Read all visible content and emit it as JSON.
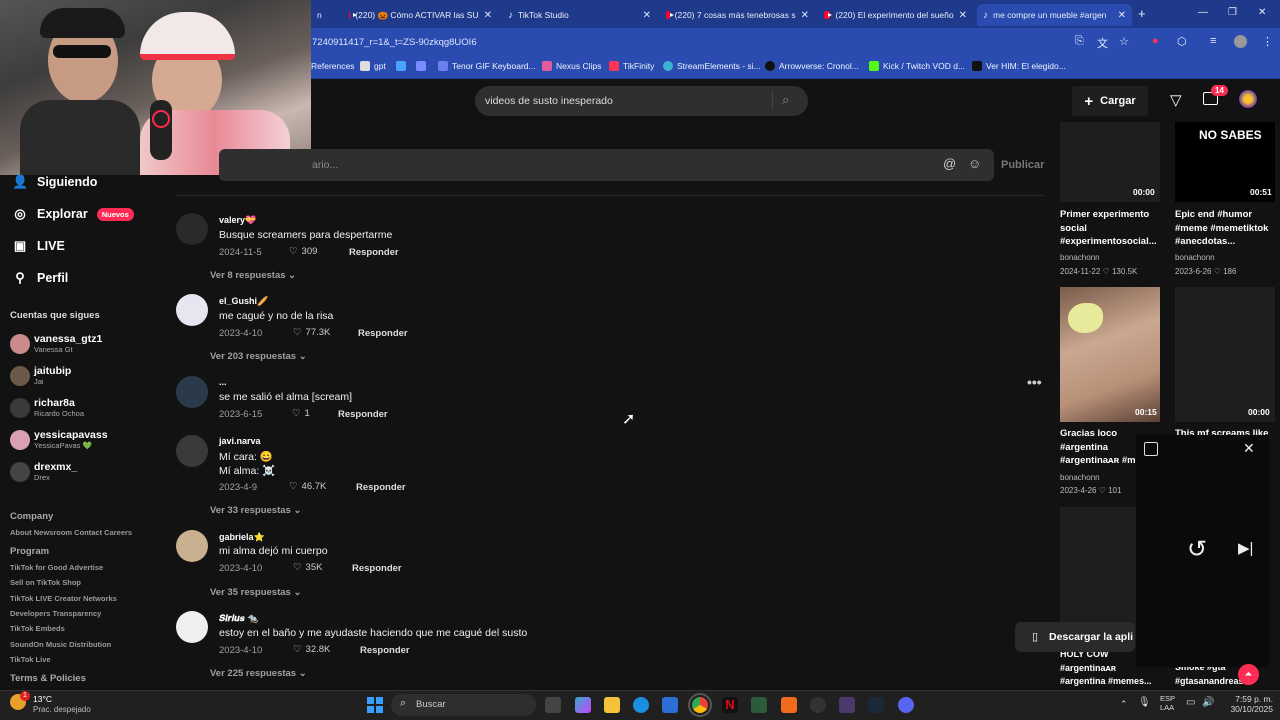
{
  "browser": {
    "tabs": [
      {
        "label": "n",
        "icon": "none"
      },
      {
        "label": "(220) 🎃 Cómo ACTIVAR las SU",
        "icon": "youtube-icon"
      },
      {
        "label": "TikTok Studio",
        "icon": "tiktok-icon"
      },
      {
        "label": "(220) 7 cosas más tenebrosas s",
        "icon": "youtube-icon"
      },
      {
        "label": "(220) El experimento del sueño",
        "icon": "youtube-icon"
      },
      {
        "label": "me compre un mueble #argen",
        "icon": "tiktok-icon"
      }
    ],
    "url": "7240911417_r=1&_t=ZS-90zkqg8UOI6",
    "bookmarks": [
      "References",
      "gpt",
      "Tenor GIF Keyboard...",
      "Nexus Clips",
      "TikFinity",
      "StreamElements - si...",
      "Arrowverse: Cronol...",
      "Kick / Twitch VOD d...",
      "Ver HIM: El elegido..."
    ],
    "window_controls": {
      "minimize": "—",
      "restore": "❐",
      "close": "✕"
    }
  },
  "header": {
    "search_value": "videos de susto inesperado",
    "upload_label": "Cargar",
    "inbox_count": "14"
  },
  "sidebar": {
    "nav": [
      {
        "label": "Siguiendo",
        "icon": "person-icon"
      },
      {
        "label": "Explorar",
        "icon": "compass-icon",
        "badge": "Nuevos"
      },
      {
        "label": "LIVE",
        "icon": "live-icon"
      },
      {
        "label": "Perfil",
        "icon": "profile-icon"
      }
    ],
    "following_title": "Cuentas que sigues",
    "following": [
      {
        "name": "vanessa_gtz1",
        "sub": "Vanessa Gt",
        "color": "#c98b8b"
      },
      {
        "name": "jaitubip",
        "sub": "Jai",
        "color": "#6b5a4a"
      },
      {
        "name": "richar8a",
        "sub": "Ricardo Ochoa",
        "color": "#3a3a3a"
      },
      {
        "name": "yessicapavass",
        "sub": "YessicaPavas 💚",
        "color": "#d8a0b0"
      },
      {
        "name": "drexmx_",
        "sub": "Drex",
        "color": "#444"
      }
    ],
    "footer": {
      "company_title": "Company",
      "company_links": "About  Newsroom  Contact  Careers",
      "program_title": "Program",
      "program_links": [
        "TikTok for Good  Advertise",
        "Sell on TikTok Shop",
        "TikTok LIVE Creator Networks",
        "Developers  Transparency",
        "TikTok Embeds",
        "SoundOn Music Distribution",
        "TikTok Live"
      ],
      "terms_title": "Terms & Policies"
    }
  },
  "comments": {
    "input_placeholder": "ario...",
    "publish_label": "Publicar",
    "reply_label": "Responder",
    "items": [
      {
        "user": "valery💝",
        "text": "Busque screamers para despertarme",
        "date": "2024-11-5",
        "likes": "309",
        "more": "Ver 8 respuestas",
        "avatar": "#2a2a2a"
      },
      {
        "user": "el_Gushi🥖",
        "text": "me cagué y no de la risa",
        "date": "2023-4-10",
        "likes": "77.3K",
        "more": "Ver 203 respuestas",
        "avatar": "#e8e4f0"
      },
      {
        "user": "...",
        "text": "se me salió el alma [scream]",
        "date": "2023-6-15",
        "likes": "1",
        "more": "",
        "avatar": "#2a3a4a"
      },
      {
        "user": "javi.narva",
        "text": "Mí cara: 😄",
        "text2": "Mí alma: ☠️",
        "date": "2023-4-9",
        "likes": "46.7K",
        "more": "Ver 33 respuestas",
        "avatar": "#3a3a3a"
      },
      {
        "user": "gabriela⭐",
        "text": "mi alma dejó mi cuerpo",
        "date": "2023-4-10",
        "likes": "35K",
        "more": "Ver 35 respuestas",
        "avatar": "#c8b090"
      },
      {
        "user": "𝑺𝒊𝒓𝒊𝒖𝒔 🐀",
        "text": "estoy en el baño y me ayudaste haciendo que me cagué del susto",
        "date": "2023-4-10",
        "likes": "32.8K",
        "more": "Ver 225 respuestas",
        "avatar": "#f0f0f0"
      }
    ]
  },
  "videos": [
    {
      "title": "Primer experimento social #experimentosocial...",
      "author": "bonachonn",
      "date": "2024-11-22",
      "likes": "130.5K",
      "duration": "00:00",
      "overlay": ""
    },
    {
      "title": "Epic end #humor #meme #memetiktok #anecdotas...",
      "author": "bonachonn",
      "date": "2023-6-26",
      "likes": "186",
      "duration": "00:51",
      "overlay": "NO SABES"
    },
    {
      "title": "Gracias loco #argentina #argentinaᴀʀ #m",
      "author": "bonachonn",
      "date": "2023-4-26",
      "likes": "101",
      "duration": "00:15",
      "overlay": ""
    },
    {
      "title": "This mf screams like a",
      "author": "",
      "date": "",
      "likes": "",
      "duration": "00:00",
      "overlay": ""
    },
    {
      "title": "HOLY COW #argentinaᴀʀ #argentina #memes...",
      "author": "",
      "date": "",
      "likes": "",
      "duration": "",
      "overlay": ""
    },
    {
      "title": "Smoke #gta #gtasanandreas...",
      "author": "",
      "date": "",
      "likes": "",
      "duration": "",
      "overlay": ""
    }
  ],
  "download_label": "Descargar la apli",
  "taskbar": {
    "weather_temp": "13°C",
    "weather_desc": "Prac. despejado",
    "weather_badge": "1",
    "search_label": "Buscar",
    "lang1": "ESP",
    "lang2": "LAA",
    "time": "7:59 p. m.",
    "date": "30/10/2025"
  }
}
